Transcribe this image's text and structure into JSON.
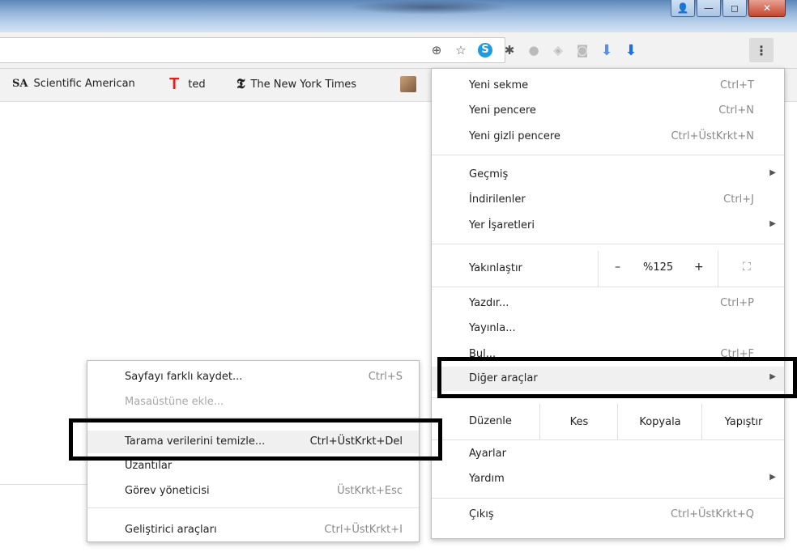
{
  "window": {
    "buttons": [
      {
        "name": "user-profile-button",
        "glyph": "👤"
      },
      {
        "name": "minimize-button",
        "glyph": "—"
      },
      {
        "name": "maximize-button",
        "glyph": "◻"
      },
      {
        "name": "close-button",
        "glyph": "✕"
      }
    ]
  },
  "toolbar": {
    "icons": [
      {
        "name": "zoom-icon",
        "glyph": "⊕",
        "cls": ""
      },
      {
        "name": "bookmark-star-icon",
        "glyph": "☆",
        "cls": ""
      },
      {
        "name": "skype-icon",
        "glyph": "S",
        "cls": "sk"
      },
      {
        "name": "extensions-puzzle-icon",
        "glyph": "✱",
        "cls": ""
      },
      {
        "name": "chat-bubble-icon",
        "glyph": "●",
        "cls": "gray"
      },
      {
        "name": "evernote-icon",
        "glyph": "◈",
        "cls": "gray"
      },
      {
        "name": "camera-icon",
        "glyph": "◙",
        "cls": "gray"
      },
      {
        "name": "download-icon-light",
        "glyph": "⬇",
        "cls": "dl1"
      },
      {
        "name": "download-icon",
        "glyph": "⬇",
        "cls": "dl2"
      }
    ],
    "menu_glyph": "⋮"
  },
  "bookmarks": [
    {
      "icon": "SA",
      "label": "Scientific American"
    },
    {
      "icon": "T",
      "label": "ted"
    },
    {
      "icon": "𝕿",
      "label": "The New York Times"
    }
  ],
  "menu": {
    "new_tab": {
      "label": "Yeni sekme",
      "shortcut": "Ctrl+T"
    },
    "new_window": {
      "label": "Yeni pencere",
      "shortcut": "Ctrl+N"
    },
    "incognito": {
      "label": "Yeni gizli pencere",
      "shortcut": "Ctrl+ÜstKrkt+N"
    },
    "history": {
      "label": "Geçmiş"
    },
    "downloads": {
      "label": "İndirilenler",
      "shortcut": "Ctrl+J"
    },
    "bookmarks": {
      "label": "Yer İşaretleri"
    },
    "zoom": {
      "label": "Yakınlaştır",
      "minus": "–",
      "value": "%125",
      "plus": "+",
      "fullscreen": "⛶"
    },
    "print": {
      "label": "Yazdır...",
      "shortcut": "Ctrl+P"
    },
    "cast": {
      "label": "Yayınla..."
    },
    "find": {
      "label": "Bul...",
      "shortcut": "Ctrl+F"
    },
    "more_tools": {
      "label": "Diğer araçlar"
    },
    "edit": {
      "label": "Düzenle",
      "cut": "Kes",
      "copy": "Kopyala",
      "paste": "Yapıştır"
    },
    "settings": {
      "label": "Ayarlar"
    },
    "help": {
      "label": "Yardım"
    },
    "exit": {
      "label": "Çıkış",
      "shortcut": "Ctrl+ÜstKrkt+Q"
    },
    "arrow": "▶"
  },
  "submenu": {
    "save_as": {
      "label": "Sayfayı farklı kaydet...",
      "shortcut": "Ctrl+S"
    },
    "add_to_desktop": {
      "label": "Masaüstüne ekle..."
    },
    "clear_data": {
      "label": "Tarama verilerini temizle...",
      "shortcut": "Ctrl+ÜstKrkt+Del"
    },
    "extensions": {
      "label": "Uzantılar"
    },
    "task_manager": {
      "label": "Görev yöneticisi",
      "shortcut": "ÜstKrkt+Esc"
    },
    "dev_tools": {
      "label": "Geliştirici araçları",
      "shortcut": "Ctrl+ÜstKrkt+I"
    }
  }
}
